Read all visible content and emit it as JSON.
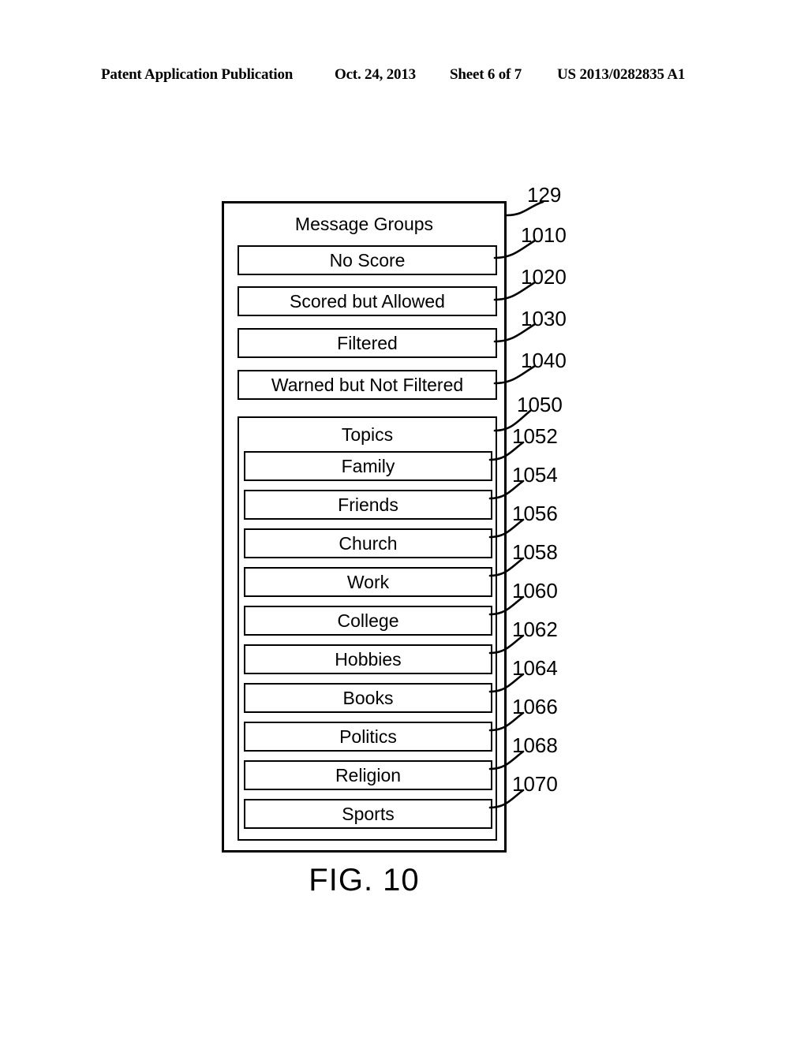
{
  "header": {
    "publication": "Patent Application Publication",
    "date": "Oct. 24, 2013",
    "sheet": "Sheet 6 of 7",
    "patent_number": "US 2013/0282835 A1"
  },
  "figure": {
    "caption": "FIG. 10",
    "container": {
      "title": "Message Groups",
      "ref": "129"
    },
    "groups": [
      {
        "label": "No Score",
        "ref": "1010"
      },
      {
        "label": "Scored but Allowed",
        "ref": "1020"
      },
      {
        "label": "Filtered",
        "ref": "1030"
      },
      {
        "label": "Warned but Not Filtered",
        "ref": "1040"
      }
    ],
    "topics": {
      "title": "Topics",
      "ref": "1050",
      "items": [
        {
          "label": "Family",
          "ref": "1052"
        },
        {
          "label": "Friends",
          "ref": "1054"
        },
        {
          "label": "Church",
          "ref": "1056"
        },
        {
          "label": "Work",
          "ref": "1058"
        },
        {
          "label": "College",
          "ref": "1060"
        },
        {
          "label": "Hobbies",
          "ref": "1062"
        },
        {
          "label": "Books",
          "ref": "1064"
        },
        {
          "label": "Politics",
          "ref": "1066"
        },
        {
          "label": "Religion",
          "ref": "1068"
        },
        {
          "label": "Sports",
          "ref": "1070"
        }
      ]
    }
  }
}
